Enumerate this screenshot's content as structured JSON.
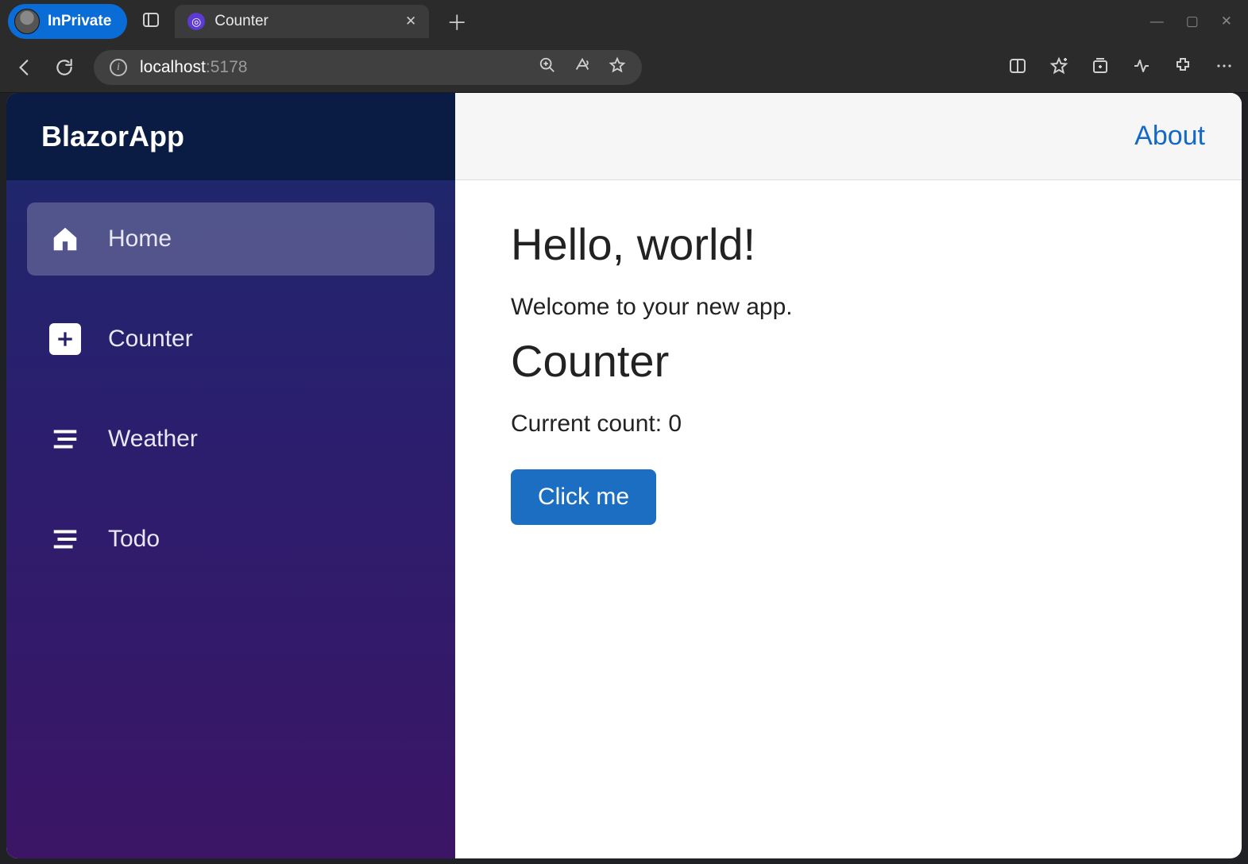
{
  "browser": {
    "inprivate_label": "InPrivate",
    "tab_title": "Counter",
    "url_host": "localhost",
    "url_port": ":5178"
  },
  "sidebar": {
    "brand": "BlazorApp",
    "items": [
      {
        "label": "Home"
      },
      {
        "label": "Counter"
      },
      {
        "label": "Weather"
      },
      {
        "label": "Todo"
      }
    ]
  },
  "header": {
    "about": "About"
  },
  "page": {
    "hello_heading": "Hello, world!",
    "welcome_text": "Welcome to your new app.",
    "counter_heading": "Counter",
    "count_label": "Current count: 0",
    "button_label": "Click me"
  }
}
